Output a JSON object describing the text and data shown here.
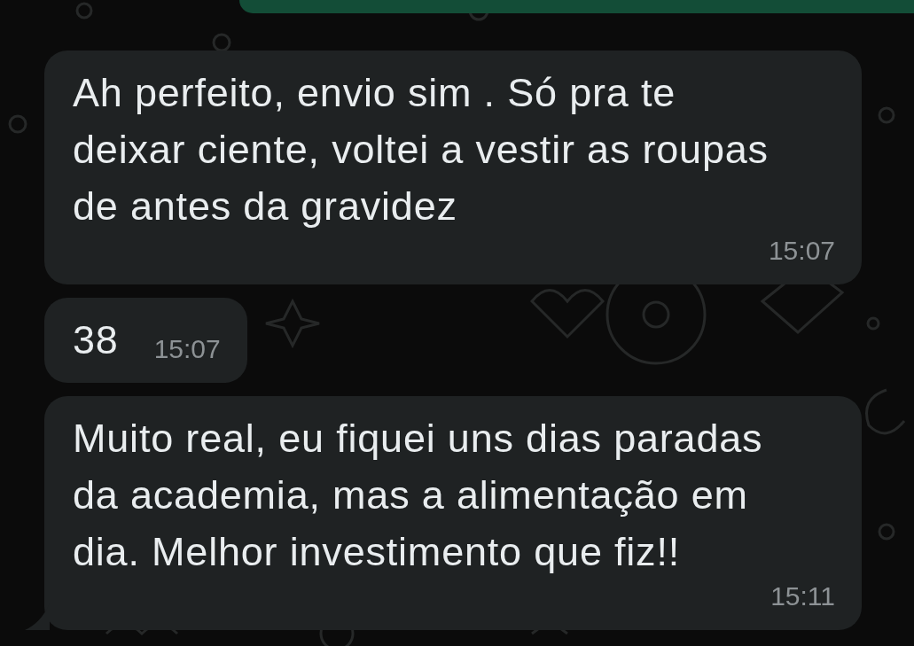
{
  "messages": [
    {
      "kind": "sent"
    },
    {
      "kind": "received",
      "lines": [
        "Ah perfeito, envio sim . Só pra te",
        "deixar ciente, voltei a vestir as roupas",
        "de antes da gravidez"
      ],
      "time": "15:07"
    },
    {
      "kind": "received",
      "lines": [
        "38"
      ],
      "time": "15:07"
    },
    {
      "kind": "received",
      "lines": [
        "Muito real, eu fiquei uns dias paradas",
        "da academia, mas a alimentação em",
        "dia. Melhor investimento que fiz!!"
      ],
      "time": "15:11",
      "tail": true
    }
  ]
}
